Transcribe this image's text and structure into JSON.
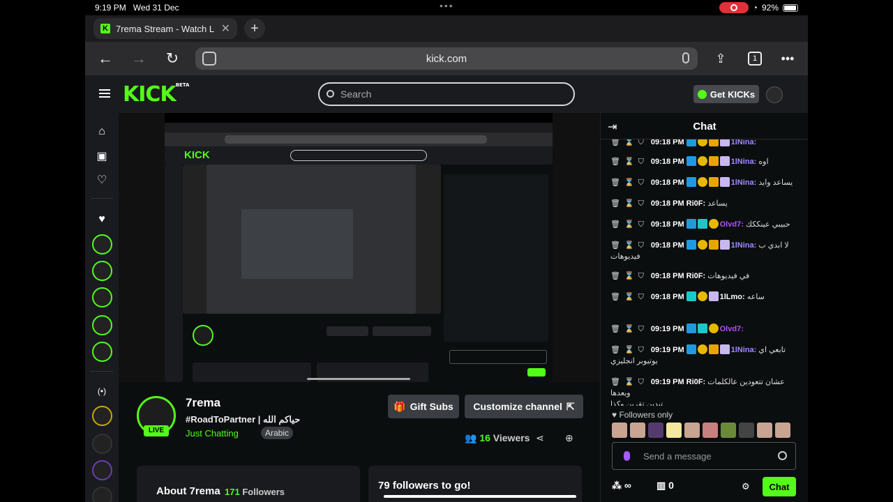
{
  "status": {
    "time": "9:19 PM",
    "date": "Wed 31 Dec",
    "battery": "92%"
  },
  "browser": {
    "tab_title": "7rema Stream - Watch L",
    "url": "kick.com",
    "tab_count": "1"
  },
  "header": {
    "logo": "KICK",
    "beta": "BETA",
    "search_placeholder": "Search",
    "get_kicks": "Get KICKs"
  },
  "channel": {
    "name": "7rema",
    "title": "#RoadToPartner | حياكم الله",
    "category": "Just Chatting",
    "tag": "Arabic",
    "live": "LIVE",
    "gift_subs": "Gift Subs",
    "customize": "Customize channel",
    "viewers_count": "16",
    "viewers_label": "Viewers",
    "about_title": "About 7rema",
    "followers_count": "171",
    "followers_label": "Followers",
    "goal": "79 followers to go!"
  },
  "chat": {
    "title": "Chat",
    "messages": [
      {
        "time": "09:18 PM",
        "user": "1lNina",
        "text": "",
        "style": "u-blue"
      },
      {
        "time": "09:18 PM",
        "user": "1lNina",
        "text": "اوه",
        "style": "u-blue"
      },
      {
        "time": "09:18 PM",
        "user": "1lNina",
        "text": "يساعد وايد",
        "style": "u-blue"
      },
      {
        "time": "09:18 PM",
        "user": "Ri0F",
        "text": "يساعد",
        "style": "u-white"
      },
      {
        "time": "09:18 PM",
        "user": "Olvd7",
        "text": "حبيبي عينككك",
        "style": "u-green"
      },
      {
        "time": "09:18 PM",
        "user": "1lNina",
        "text": "لا ابدي ب",
        "text2": "فيديوهات",
        "style": "u-blue"
      },
      {
        "time": "09:18 PM",
        "user": "Ri0F",
        "text": "في فيديوهات",
        "style": "u-white"
      },
      {
        "time": "09:18 PM",
        "user": "1lLmo",
        "text": "ساعه",
        "style": "u-white"
      },
      {
        "time": "09:19 PM",
        "user": "Olvd7",
        "text": "",
        "style": "u-green"
      },
      {
        "time": "09:19 PM",
        "user": "1lNina",
        "text": "تابعي اي",
        "text2": "يوتيوبر انجليزي",
        "style": "u-blue"
      },
      {
        "time": "09:19 PM",
        "user": "Ri0F",
        "text": "عشان تتعودين عالكلمات وبعدها",
        "text2": "تبدين تقرين وكذا",
        "style": "u-white"
      }
    ],
    "followers_only": "Followers only",
    "placeholder": "Send a message",
    "kicks_count": "0",
    "send": "Chat"
  }
}
